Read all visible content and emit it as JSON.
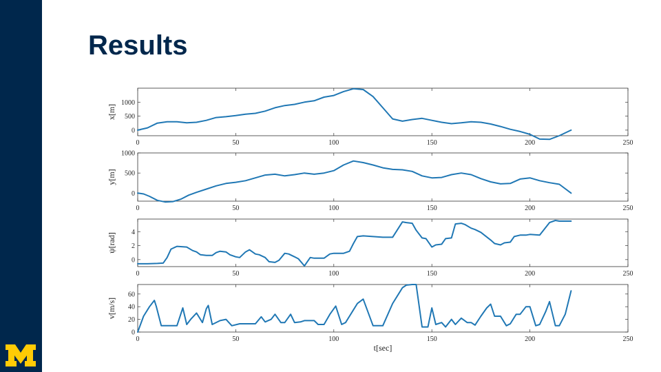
{
  "slide": {
    "title": "Results"
  },
  "colors": {
    "sidebar": "#00274c",
    "logo": "#ffcb05",
    "series": "#1f77b4",
    "title": "#00274c"
  },
  "logo": {
    "letter": "M"
  },
  "chart_data": [
    {
      "type": "line",
      "ylabel": "x[m]",
      "xlabel": "",
      "xlim": [
        0,
        250
      ],
      "ylim": [
        -200,
        1500
      ],
      "xticks": [
        0,
        50,
        100,
        150,
        200,
        250
      ],
      "yticks": [
        0,
        500,
        1000
      ],
      "grid": false,
      "series": [
        {
          "x": [
            0,
            5,
            10,
            15,
            20,
            25,
            30,
            35,
            40,
            45,
            50,
            55,
            60,
            65,
            70,
            75,
            80,
            85,
            90,
            95,
            100,
            105,
            110,
            115,
            120,
            125,
            130,
            135,
            140,
            145,
            150,
            155,
            160,
            165,
            170,
            175,
            180,
            185,
            190,
            195,
            200,
            205,
            210,
            215,
            221
          ],
          "y": [
            0,
            80,
            250,
            300,
            300,
            260,
            280,
            350,
            450,
            480,
            520,
            570,
            600,
            680,
            800,
            880,
            920,
            1000,
            1050,
            1180,
            1240,
            1380,
            1480,
            1450,
            1200,
            800,
            400,
            320,
            380,
            420,
            350,
            280,
            230,
            260,
            300,
            280,
            220,
            130,
            30,
            -50,
            -150,
            -320,
            -330,
            -200,
            0
          ]
        }
      ]
    },
    {
      "type": "line",
      "ylabel": "y[m]",
      "xlabel": "",
      "xlim": [
        0,
        250
      ],
      "ylim": [
        -200,
        1000
      ],
      "xticks": [
        0,
        50,
        100,
        150,
        200,
        250
      ],
      "yticks": [
        0,
        500,
        1000
      ],
      "grid": false,
      "series": [
        {
          "x": [
            0,
            3,
            6,
            10,
            14,
            18,
            22,
            26,
            30,
            35,
            40,
            45,
            50,
            55,
            60,
            65,
            70,
            75,
            80,
            85,
            90,
            95,
            100,
            105,
            110,
            115,
            120,
            125,
            130,
            135,
            140,
            145,
            150,
            155,
            160,
            165,
            170,
            175,
            180,
            185,
            190,
            195,
            200,
            205,
            210,
            215,
            221
          ],
          "y": [
            0,
            -20,
            -80,
            -180,
            -220,
            -210,
            -150,
            -50,
            20,
            100,
            180,
            240,
            270,
            310,
            380,
            450,
            470,
            430,
            460,
            500,
            470,
            500,
            560,
            700,
            800,
            760,
            700,
            630,
            590,
            580,
            540,
            430,
            380,
            390,
            460,
            500,
            460,
            360,
            280,
            230,
            240,
            350,
            380,
            310,
            260,
            220,
            0
          ]
        }
      ]
    },
    {
      "type": "line",
      "ylabel": "ψ[rad]",
      "xlabel": "",
      "xlim": [
        0,
        250
      ],
      "ylim": [
        -1,
        5.8
      ],
      "xticks": [
        0,
        50,
        100,
        150,
        200,
        250
      ],
      "yticks": [
        0,
        2,
        4
      ],
      "grid": false,
      "series": [
        {
          "x": [
            0,
            5,
            10,
            13,
            15,
            17,
            20,
            25,
            28,
            30,
            32,
            35,
            38,
            40,
            42,
            45,
            47,
            50,
            52,
            55,
            57,
            60,
            62,
            65,
            67,
            70,
            72,
            75,
            77,
            80,
            82,
            85,
            88,
            90,
            95,
            98,
            100,
            105,
            108,
            110,
            112,
            115,
            120,
            125,
            130,
            135,
            137,
            140,
            142,
            145,
            147,
            150,
            152,
            155,
            157,
            160,
            162,
            165,
            167,
            170,
            172,
            175,
            180,
            182,
            185,
            187,
            190,
            192,
            195,
            198,
            200,
            205,
            210,
            213,
            215,
            221
          ],
          "y": [
            -0.6,
            -0.6,
            -0.55,
            -0.5,
            0.3,
            1.5,
            1.9,
            1.8,
            1.3,
            1.1,
            0.7,
            0.6,
            0.6,
            1.0,
            1.2,
            1.1,
            0.7,
            0.4,
            0.3,
            1.1,
            1.4,
            0.8,
            0.7,
            0.3,
            -0.3,
            -0.4,
            -0.1,
            0.9,
            0.8,
            0.4,
            0.1,
            -0.9,
            0.3,
            0.2,
            0.2,
            0.8,
            0.9,
            0.9,
            1.2,
            2.3,
            3.3,
            3.4,
            3.3,
            3.2,
            3.2,
            5.4,
            5.3,
            5.2,
            4.2,
            3.1,
            3.0,
            1.8,
            2.1,
            2.2,
            3.0,
            3.1,
            5.1,
            5.2,
            5.0,
            4.5,
            4.3,
            3.9,
            2.8,
            2.3,
            2.1,
            2.4,
            2.5,
            3.3,
            3.5,
            3.5,
            3.6,
            3.5,
            5.3,
            5.6,
            5.5,
            5.5
          ]
        }
      ]
    },
    {
      "type": "line",
      "ylabel": "v[m/s]",
      "xlabel": "t[sec]",
      "xlim": [
        0,
        250
      ],
      "ylim": [
        0,
        75
      ],
      "xticks": [
        0,
        50,
        100,
        150,
        200,
        250
      ],
      "yticks": [
        0,
        20,
        40,
        60
      ],
      "grid": false,
      "series": [
        {
          "x": [
            0,
            3,
            6,
            8.5,
            9.5,
            12,
            15,
            18,
            20,
            23,
            25,
            27,
            30,
            33,
            35,
            36,
            38,
            42,
            45,
            48,
            52,
            55,
            58,
            60,
            63,
            65,
            68,
            70,
            73,
            75,
            78,
            80,
            83,
            85,
            88,
            90,
            92,
            95,
            98,
            101,
            104,
            106,
            110,
            112,
            115,
            120,
            125,
            130,
            133,
            135,
            137,
            140,
            142,
            145,
            148,
            150,
            152,
            155,
            157,
            160,
            162,
            165,
            168,
            170,
            172,
            175,
            178,
            180,
            182,
            185,
            188,
            190,
            193,
            195,
            198,
            200,
            203,
            205,
            208,
            210,
            213,
            215,
            218,
            221
          ],
          "y": [
            0,
            25,
            40,
            50,
            40,
            10,
            10,
            10,
            10,
            38,
            12,
            20,
            30,
            15,
            37,
            42,
            12,
            18,
            20,
            10,
            13,
            13,
            13,
            13,
            24,
            16,
            20,
            28,
            15,
            15,
            28,
            15,
            16,
            18,
            18,
            18,
            12,
            12,
            28,
            41,
            12,
            15,
            35,
            45,
            52,
            10,
            10,
            45,
            60,
            70,
            74,
            75,
            75,
            8,
            8,
            38,
            12,
            15,
            8,
            20,
            12,
            22,
            15,
            15,
            11,
            25,
            38,
            44,
            25,
            25,
            10,
            13,
            28,
            28,
            40,
            40,
            10,
            12,
            32,
            48,
            10,
            10,
            28,
            65
          ]
        }
      ]
    }
  ]
}
